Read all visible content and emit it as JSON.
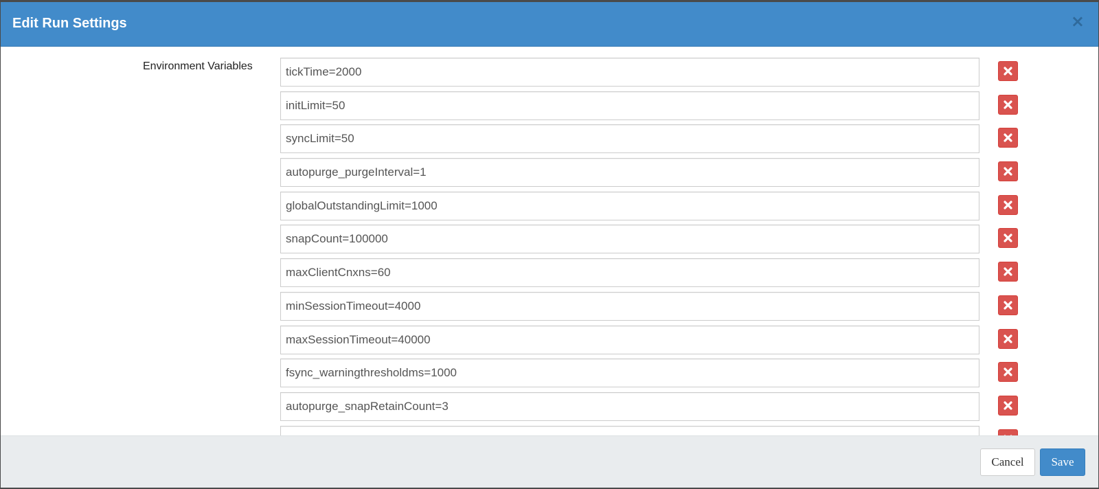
{
  "dialog": {
    "title": "Edit Run Settings",
    "close_glyph": "×"
  },
  "env": {
    "label": "Environment Variables",
    "items": [
      "tickTime=2000",
      "initLimit=50",
      "syncLimit=50",
      "autopurge_purgeInterval=1",
      "globalOutstandingLimit=1000",
      "snapCount=100000",
      "maxClientCnxns=60",
      "minSessionTimeout=4000",
      "maxSessionTimeout=40000",
      "fsync_warningthresholdms=1000",
      "autopurge_snapRetainCount=3",
      ""
    ],
    "remove_icon": "remove-icon"
  },
  "footer": {
    "cancel_label": "Cancel",
    "save_label": "Save"
  },
  "colors": {
    "header": "#428bca",
    "danger": "#d9534f",
    "primary": "#428bca",
    "footer_bg": "#e9ecee"
  }
}
